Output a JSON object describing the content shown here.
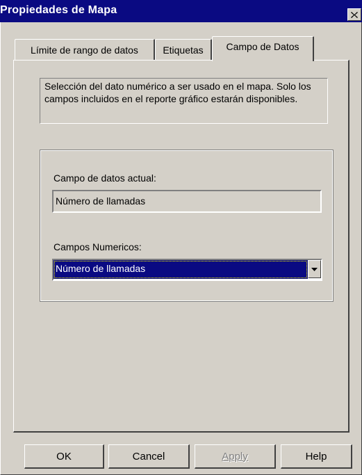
{
  "window": {
    "title": "Propiedades de Mapa"
  },
  "tabs": [
    {
      "label": "Límite de rango de datos",
      "selected": false
    },
    {
      "label": "Etiquetas",
      "selected": false
    },
    {
      "label": "Campo de Datos",
      "selected": true
    }
  ],
  "panel": {
    "description": "Selección del dato numérico a ser usado en el mapa. Solo los campos incluidos en el reporte gráfico estarán disponibles.",
    "current_field_label": "Campo de datos actual:",
    "current_field_value": "Número de llamadas",
    "numeric_fields_label": "Campos Numericos:",
    "numeric_fields_selected": "Número de llamadas"
  },
  "buttons": {
    "ok": "OK",
    "cancel": "Cancel",
    "apply": "Apply",
    "help": "Help"
  },
  "colors": {
    "titlebar": "#0a0a82",
    "face": "#d4d0c8",
    "selection": "#0a0a82"
  },
  "icons": {
    "close": "close-icon",
    "dropdown": "chevron-down-icon"
  }
}
